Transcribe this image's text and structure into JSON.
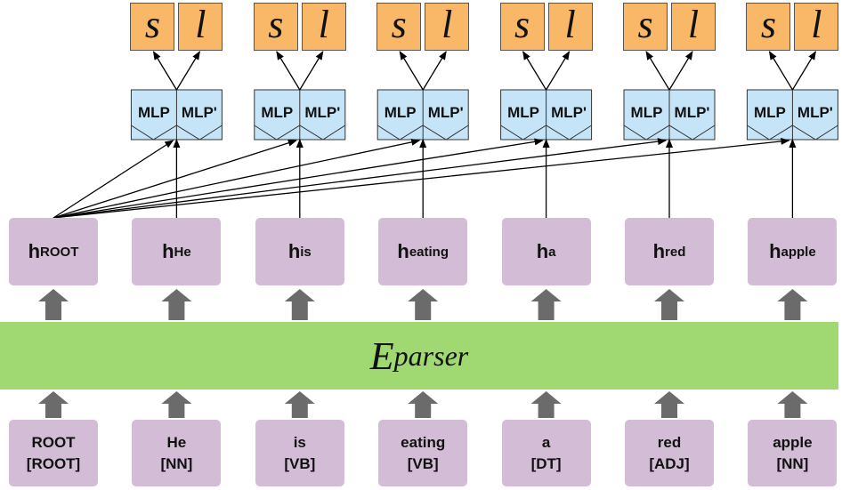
{
  "encoder": {
    "label": "E",
    "subscript": "parser"
  },
  "mlp_labels": {
    "left": "MLP",
    "right": "MLP'"
  },
  "output_labels": {
    "left": "s",
    "right": "l"
  },
  "hidden_prefix": "h",
  "tokens": [
    {
      "word": "ROOT",
      "tag": "[ROOT]",
      "h_sub": "ROOT"
    },
    {
      "word": "He",
      "tag": "[NN]",
      "h_sub": "He"
    },
    {
      "word": "is",
      "tag": "[VB]",
      "h_sub": "is"
    },
    {
      "word": "eating",
      "tag": "[VB]",
      "h_sub": "eating"
    },
    {
      "word": "a",
      "tag": "[DT]",
      "h_sub": "a"
    },
    {
      "word": "red",
      "tag": "[ADJ]",
      "h_sub": "red"
    },
    {
      "word": "apple",
      "tag": "[NN]",
      "h_sub": "apple"
    }
  ],
  "colors": {
    "output": "#f8b868",
    "mlp": "#c6e4f7",
    "token": "#d3bcd5",
    "encoder": "#a0d872",
    "arrow": "#6b6b6b"
  }
}
